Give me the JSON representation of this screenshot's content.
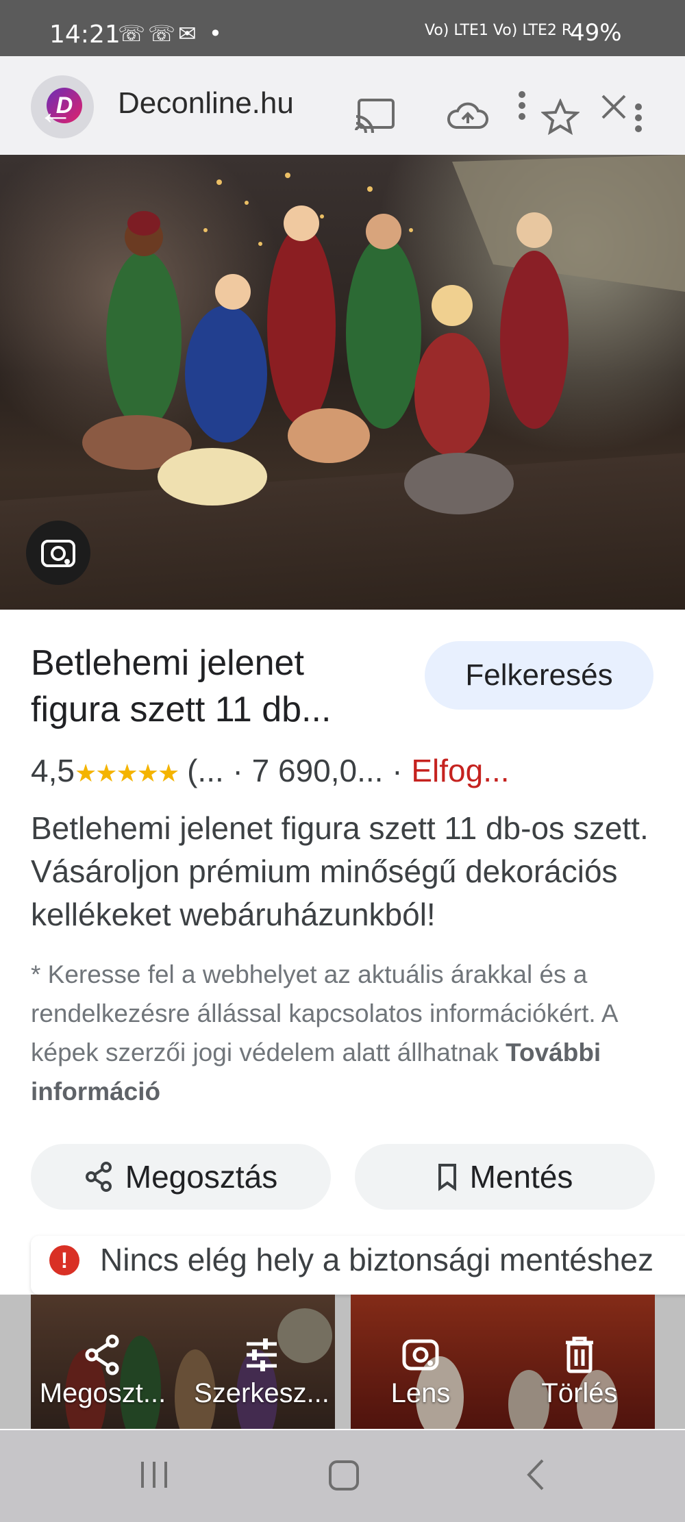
{
  "status": {
    "time": "14:21",
    "notif_icons": "☏☏✉ •",
    "network": "Vo) LTE1 Vo) LTE2 R",
    "battery": "49%"
  },
  "header": {
    "site": "Deconline.hu",
    "logo_letter": "D"
  },
  "product": {
    "title_line1": "Betlehemi jelenet",
    "title_line2": "figura szett 11 db...",
    "visit_label": "Felkeresés",
    "rating_value": "4,5",
    "stars": "★★★★★",
    "rating_rest": "(... · 7 690,0...",
    "stock_sep": " · ",
    "stock": "Elfog...",
    "description": "Betlehemi jelenet figura szett 11 db-os szett. Vásároljon prémium minőségű dekorációs kellékeket webáruházunkból!",
    "note": "* Keresse fel a webhelyet az aktuális árakkal és a rendelkezésre állással kapcsolatos információkért. A képek szerzői jogi védelem alatt állhatnak",
    "more_info": "További információ",
    "rating_fraction": 0.9
  },
  "actions": {
    "share": "Megosztás",
    "save": "Mentés"
  },
  "snackbar": {
    "text": "Nincs elég hely a biztonsági mentéshez"
  },
  "overlay": {
    "share": "Megoszt...",
    "edit": "Szerkesz...",
    "lens": "Lens",
    "delete": "Törlés"
  },
  "colors": {
    "accent_button_bg": "#e8f0fe",
    "stock_red": "#c5221f",
    "star_gold": "#f4b400"
  }
}
